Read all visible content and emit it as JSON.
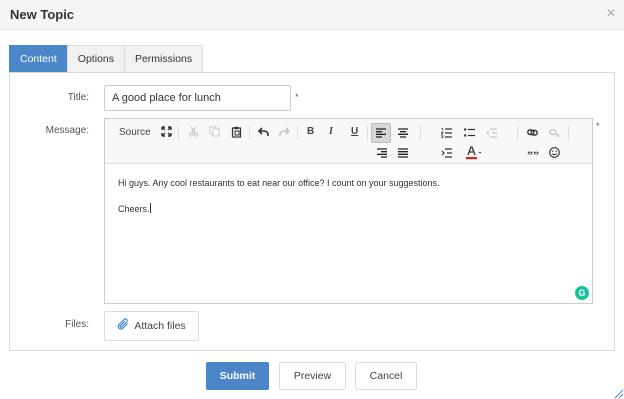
{
  "dialog": {
    "title": "New Topic",
    "close_icon": "close-icon"
  },
  "tabs": [
    {
      "label": "Content",
      "active": true
    },
    {
      "label": "Options",
      "active": false
    },
    {
      "label": "Permissions",
      "active": false
    }
  ],
  "form": {
    "title_label": "Title:",
    "title_value": "A good place for lunch",
    "required_marker": "*",
    "message_label": "Message:",
    "files_label": "Files:"
  },
  "toolbar": {
    "source_label": "Source",
    "bold": "B",
    "italic": "I",
    "underline": "U",
    "quote": "””",
    "icons": [
      "maximize-icon",
      "cut-icon",
      "copy-icon",
      "paste-icon",
      "undo-icon",
      "redo-icon",
      "align-left-icon",
      "align-center-icon",
      "align-right-icon",
      "justify-icon",
      "numbered-list-icon",
      "bulleted-list-icon",
      "outdent-icon",
      "indent-icon",
      "text-color-icon",
      "link-icon",
      "unlink-icon",
      "smiley-icon"
    ]
  },
  "editor": {
    "lines": [
      "Hi guys. Any cool restaurants to eat near our office? I count on your suggestions.",
      "Cheers."
    ],
    "grammarly_badge": "G"
  },
  "attach": {
    "label": "Attach files"
  },
  "actions": {
    "submit": "Submit",
    "preview": "Preview",
    "cancel": "Cancel"
  },
  "colors": {
    "accent": "#4a86c8",
    "text_color_bar": "#e02020",
    "grammarly": "#15c39a"
  }
}
